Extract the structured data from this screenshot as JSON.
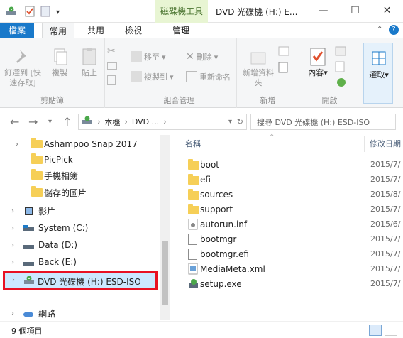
{
  "title_bar": {
    "context_tab": "磁碟機工具",
    "window_title": "DVD 光碟機 (H:) E...",
    "minimize": "—",
    "maximize": "☐",
    "close": "✕"
  },
  "tabs": [
    "檔案",
    "常用",
    "共用",
    "檢視",
    "管理"
  ],
  "ribbon": {
    "clipboard": {
      "pin": "釘選到 [快速存取]",
      "copy": "複製",
      "paste": "貼上",
      "label": "剪貼簿"
    },
    "organize": {
      "move_to": "移至",
      "copy_to": "複製到",
      "delete": "刪除",
      "rename": "重新命名",
      "label": "組合管理"
    },
    "new": {
      "new_folder": "新增資料夾",
      "label": "新增"
    },
    "open": {
      "properties": "內容",
      "label": "開啟"
    },
    "select": {
      "select": "選取"
    }
  },
  "navigation": {
    "breadcrumb_1": "本機",
    "breadcrumb_2": "DVD ...",
    "search_placeholder": "搜尋 DVD 光碟機 (H:) ESD-ISO"
  },
  "tree": [
    {
      "label": "Ashampoo Snap 2017",
      "type": "folder"
    },
    {
      "label": "PicPick",
      "type": "folder"
    },
    {
      "label": "手機相簿",
      "type": "folder"
    },
    {
      "label": "儲存的圖片",
      "type": "folder"
    },
    {
      "label": "影片",
      "type": "video"
    },
    {
      "label": "System (C:)",
      "type": "drive"
    },
    {
      "label": "Data (D:)",
      "type": "drive"
    },
    {
      "label": "Back (E:)",
      "type": "drive"
    },
    {
      "label": "DVD 光碟機 (H:) ESD-ISO",
      "type": "dvd"
    },
    {
      "label": "網路",
      "type": "network"
    }
  ],
  "list": {
    "col_name": "名稱",
    "col_date": "修改日期",
    "rows": [
      {
        "name": "boot",
        "date": "2015/7/",
        "type": "folder"
      },
      {
        "name": "efi",
        "date": "2015/7/",
        "type": "folder"
      },
      {
        "name": "sources",
        "date": "2015/8/",
        "type": "folder"
      },
      {
        "name": "support",
        "date": "2015/7/",
        "type": "folder"
      },
      {
        "name": "autorun.inf",
        "date": "2015/6/",
        "type": "inf"
      },
      {
        "name": "bootmgr",
        "date": "2015/7/",
        "type": "file"
      },
      {
        "name": "bootmgr.efi",
        "date": "2015/7/",
        "type": "file"
      },
      {
        "name": "MediaMeta.xml",
        "date": "2015/7/",
        "type": "xml"
      },
      {
        "name": "setup.exe",
        "date": "2015/7/",
        "type": "exe"
      }
    ]
  },
  "status": {
    "item_count": "9 個項目"
  },
  "colors": {
    "accent": "#1979ca",
    "context_tab_bg": "#e8f5d3",
    "highlight_border": "#e81123",
    "folder": "#f6cf57"
  }
}
